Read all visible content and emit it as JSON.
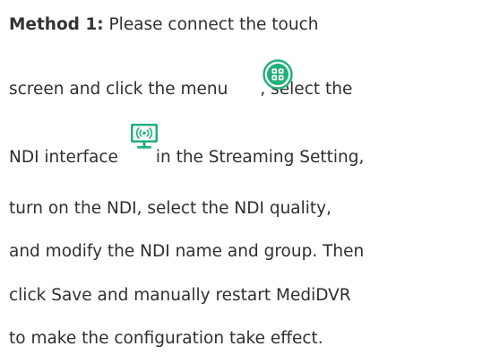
{
  "document": {
    "method_label": "Method 1:",
    "line1_rest": " Please connect the touch",
    "line2_a": "screen and click the menu",
    "line2_b": ", select the",
    "line3_a": "NDI interface",
    "line3_b": " in the Streaming Setting,",
    "line4": "turn on the NDI, select the NDI quality,",
    "line5": "and modify the NDI name and group. Then",
    "line6": "click Save and manually restart MediDVR",
    "line7": "to make the configuration take effect."
  },
  "icons": {
    "menu_icon": "menu-grid-icon",
    "ndi_icon": "ndi-monitor-broadcast-icon",
    "accent_color": "#21b07a"
  }
}
